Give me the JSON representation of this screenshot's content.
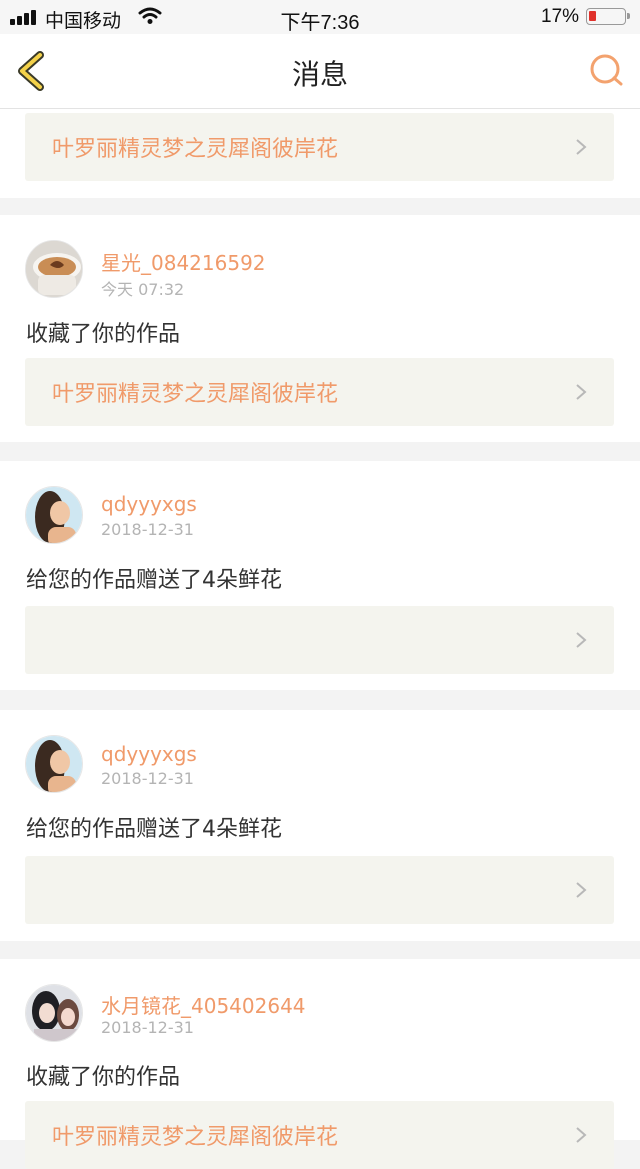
{
  "status_bar": {
    "carrier": "中国移动",
    "time": "下午7:36",
    "battery": "17%",
    "battery_level": 0.17
  },
  "header": {
    "title": "消息",
    "back_icon": "chevron-left-icon",
    "search_icon": "search-icon",
    "accent_color": "#f09a6a"
  },
  "messages": [
    {
      "work_title": "叶罗丽精灵梦之灵犀阁彼岸花"
    },
    {
      "username": "星光_084216592",
      "time": "今天 07:32",
      "action": "收藏了你的作品",
      "work_title": "叶罗丽精灵梦之灵犀阁彼岸花"
    },
    {
      "username": "qdyyyxgs",
      "time": "2018-12-31",
      "action": "给您的作品赠送了4朵鲜花",
      "work_title": ""
    },
    {
      "username": "qdyyyxgs",
      "time": "2018-12-31",
      "action": "给您的作品赠送了4朵鲜花",
      "work_title": ""
    },
    {
      "username": "水月镜花_405402644",
      "time": "2018-12-31",
      "action": "收藏了你的作品",
      "work_title": "叶罗丽精灵梦之灵犀阁彼岸花"
    }
  ]
}
